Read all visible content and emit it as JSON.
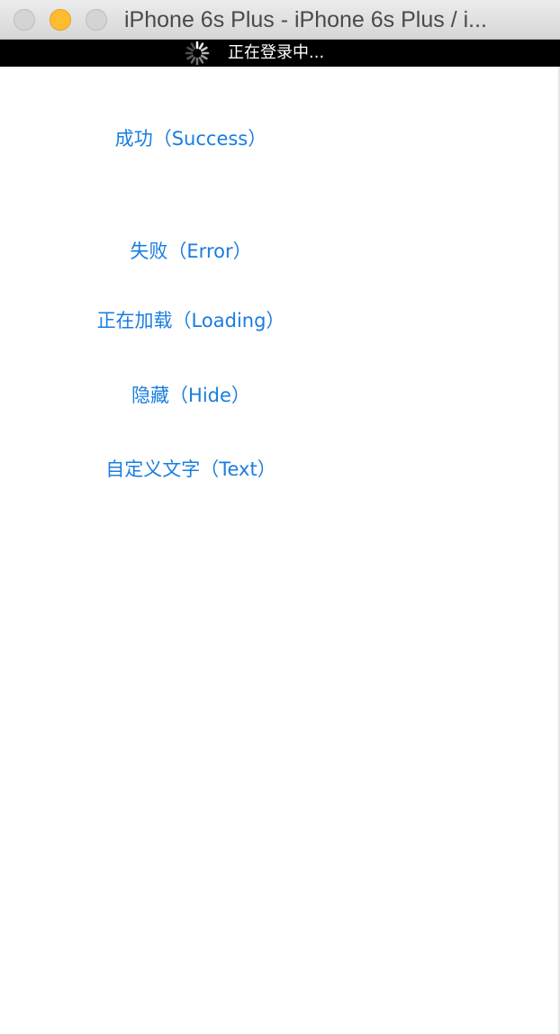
{
  "window": {
    "title": "iPhone 6s Plus - iPhone 6s Plus / i..."
  },
  "statusbar": {
    "text": "正在登录中...",
    "spinner_icon": "activity-spinner-icon"
  },
  "buttons": {
    "success": "成功（Success）",
    "error": "失败（Error）",
    "loading": "正在加载（Loading）",
    "hide": "隐藏（Hide）",
    "text": "自定义文字（Text）"
  },
  "colors": {
    "accent": "#1a7de0",
    "statusbar_bg": "#000000",
    "minimize_button": "#febc2e"
  }
}
